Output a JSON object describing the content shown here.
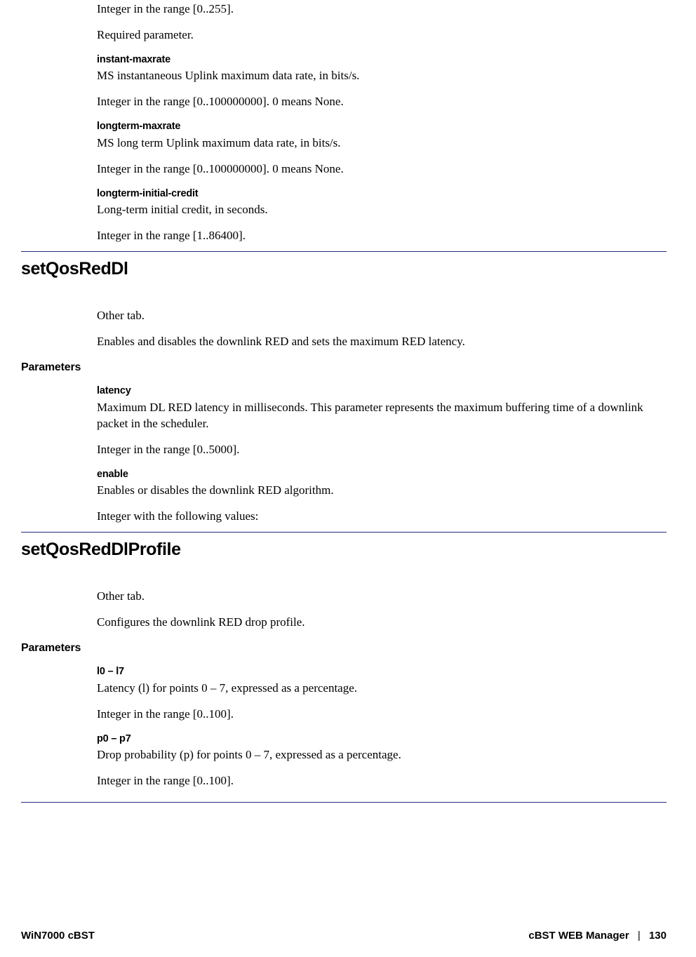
{
  "top": {
    "range1": "Integer in the range [0..255].",
    "required": "Required parameter.",
    "instant_name": "instant-maxrate",
    "instant_desc": "MS instantaneous Uplink maximum data rate, in bits/s.",
    "instant_range": "Integer in the range [0..100000000]. 0 means None.",
    "longterm_name": "longterm-maxrate",
    "longterm_desc": "MS long term Uplink maximum data rate, in bits/s.",
    "longterm_range": "Integer in the range [0..100000000]. 0 means None.",
    "credit_name": "longterm-initial-credit",
    "credit_desc": "Long-term initial credit, in seconds.",
    "credit_range": "Integer in the range [1..86400]."
  },
  "sec1": {
    "title": "setQosRedDl",
    "tab": "Other tab.",
    "desc": "Enables and disables the downlink RED and sets the maximum RED latency.",
    "params_label": "Parameters",
    "latency_name": "latency",
    "latency_desc": "Maximum DL RED latency in milliseconds. This parameter represents the maximum buffering time of a downlink packet in the scheduler.",
    "latency_range": "Integer in the range [0..5000].",
    "enable_name": "enable",
    "enable_desc": "Enables or disables the downlink RED algorithm.",
    "enable_range": "Integer with the following values:"
  },
  "sec2": {
    "title": "setQosRedDlProfile",
    "tab": "Other tab.",
    "desc": "Configures the downlink RED drop profile.",
    "params_label": "Parameters",
    "l_name": "l0 – l7",
    "l_desc": "Latency (l) for points 0 – 7, expressed as a percentage.",
    "l_range": "Integer in the range [0..100].",
    "p_name": "p0 – p7",
    "p_desc": "Drop probability (p) for points 0 – 7, expressed as a percentage.",
    "p_range": "Integer in the range [0..100]."
  },
  "footer": {
    "left": "WiN7000 cBST",
    "right_title": "cBST WEB Manager",
    "sep": "|",
    "page": "130"
  }
}
